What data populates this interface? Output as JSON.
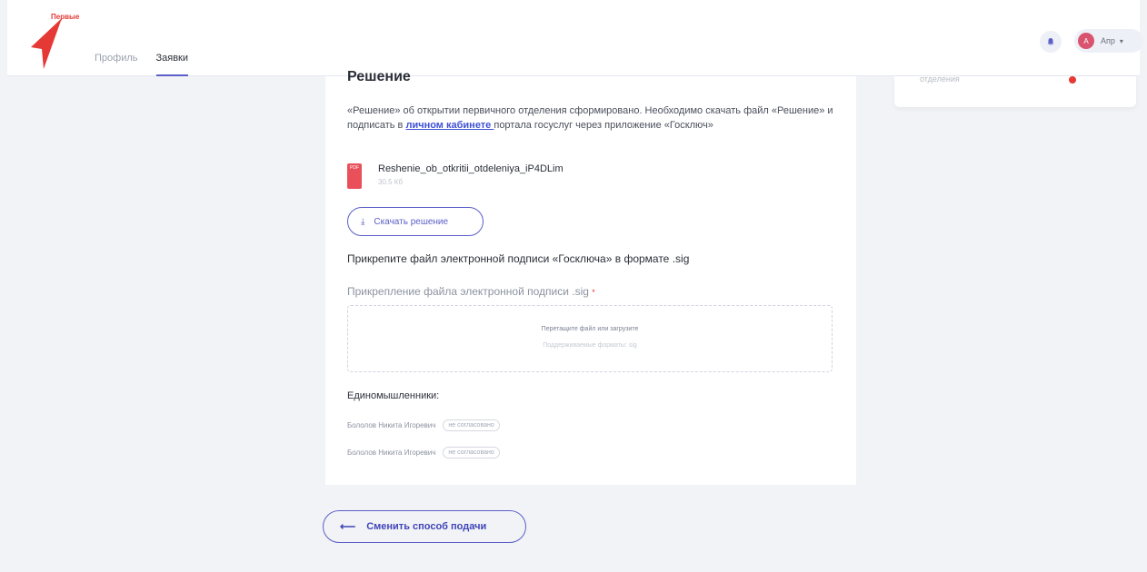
{
  "header": {
    "logo_text": "Первые",
    "nav": [
      {
        "label": "Профиль"
      },
      {
        "label": "Заявки"
      }
    ],
    "user": {
      "initial": "А",
      "name": "Апр"
    }
  },
  "right_card": {
    "faded_text": "отделения"
  },
  "main": {
    "section_title": "Решение",
    "description_before_link": "«Решение» об открытии первичного отделения сформировано. Необходимо скачать файл «Решение» и подписать в ",
    "description_link": "личном кабинете ",
    "description_after_link": "портала госуслуг через приложение «Госключ»",
    "file": {
      "icon_label": "PDF",
      "name": "Reshenie_ob_otkritii_otdeleniya_iP4DLim",
      "size": "30.5 Кб"
    },
    "download_button": "Скачать решение",
    "attach_hint": "Прикрепите файл электронной подписи «Госключа» в формате .sig",
    "signature_label": "Прикрепление файла электронной подписи .sig",
    "signature_required_mark": "*",
    "dropzone": {
      "text": "Перетащите файл или загрузите",
      "subtext": "Поддерживаемые форматы: sig"
    },
    "like_minded_title": "Единомышленники:",
    "like_minded": [
      {
        "name": "Бололов Никита Игоревич",
        "status": "не согласовано"
      },
      {
        "name": "Бололов Никита Игоревич",
        "status": "не согласовано"
      }
    ]
  },
  "back_button": "Сменить способ подачи",
  "colors": {
    "accent": "#5b5fc7",
    "brand_red": "#e53935",
    "background": "#f2f3f7"
  }
}
